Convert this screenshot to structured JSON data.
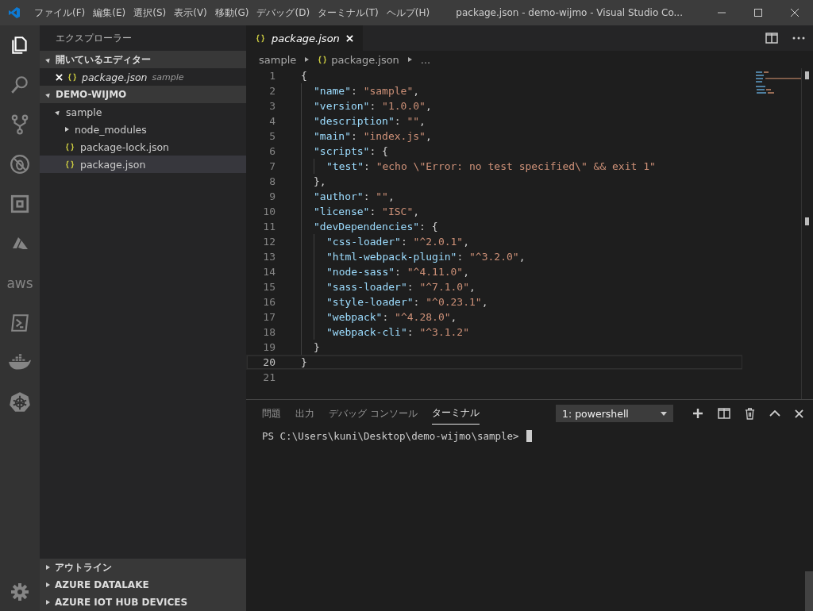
{
  "window": {
    "title": "package.json - demo-wijmo - Visual Studio Co..."
  },
  "menu": [
    "ファイル(F)",
    "編集(E)",
    "選択(S)",
    "表示(V)",
    "移動(G)",
    "デバッグ(D)",
    "ターミナル(T)",
    "ヘルプ(H)"
  ],
  "activity_bar": [
    {
      "kind": "files",
      "selected": true
    },
    {
      "kind": "search",
      "selected": false
    },
    {
      "kind": "git",
      "selected": false
    },
    {
      "kind": "debug",
      "selected": false
    },
    {
      "kind": "extensions",
      "selected": false
    },
    {
      "kind": "azure",
      "selected": false
    },
    {
      "kind": "aws",
      "label": "aws",
      "selected": false
    },
    {
      "kind": "powershell",
      "selected": false
    },
    {
      "kind": "docker",
      "selected": false
    },
    {
      "kind": "kubernetes",
      "selected": false
    }
  ],
  "sidebar": {
    "title": "エクスプローラー",
    "open_editors": {
      "title": "開いているエディター",
      "expanded": true,
      "items": [
        {
          "name": "package.json",
          "folder": "sample"
        }
      ]
    },
    "workspace": {
      "title": "DEMO-WIJMO",
      "expanded": true,
      "children": [
        {
          "name": "sample",
          "kind": "folder",
          "expanded": true,
          "selected": false,
          "children": [
            {
              "name": "node_modules",
              "kind": "folder",
              "expanded": false,
              "selected": false
            },
            {
              "name": "package-lock.json",
              "kind": "json",
              "selected": false
            },
            {
              "name": "package.json",
              "kind": "json",
              "selected": true
            }
          ]
        }
      ]
    },
    "sections": [
      {
        "title": "アウトライン",
        "expanded": false
      },
      {
        "title": "AZURE DATALAKE",
        "expanded": false
      },
      {
        "title": "AZURE IOT HUB DEVICES",
        "expanded": false
      }
    ]
  },
  "editor": {
    "tabs": [
      {
        "name": "package.json",
        "selected": true
      }
    ],
    "breadcrumbs": [
      "sample",
      "package.json",
      "..."
    ],
    "lines": [
      {
        "number": "1",
        "current": false,
        "tokens": [
          {
            "kind": "punct",
            "text": "{"
          }
        ]
      },
      {
        "number": "2",
        "current": false,
        "tokens": [
          {
            "kind": "key",
            "text": "  \"name\""
          },
          {
            "kind": "punct",
            "text": ": "
          },
          {
            "kind": "string",
            "text": "\"sample\""
          },
          {
            "kind": "punct",
            "text": ","
          }
        ]
      },
      {
        "number": "3",
        "current": false,
        "tokens": [
          {
            "kind": "key",
            "text": "  \"version\""
          },
          {
            "kind": "punct",
            "text": ": "
          },
          {
            "kind": "string",
            "text": "\"1.0.0\""
          },
          {
            "kind": "punct",
            "text": ","
          }
        ]
      },
      {
        "number": "4",
        "current": false,
        "tokens": [
          {
            "kind": "key",
            "text": "  \"description\""
          },
          {
            "kind": "punct",
            "text": ": "
          },
          {
            "kind": "string",
            "text": "\"\""
          },
          {
            "kind": "punct",
            "text": ","
          }
        ]
      },
      {
        "number": "5",
        "current": false,
        "tokens": [
          {
            "kind": "key",
            "text": "  \"main\""
          },
          {
            "kind": "punct",
            "text": ": "
          },
          {
            "kind": "string",
            "text": "\"index.js\""
          },
          {
            "kind": "punct",
            "text": ","
          }
        ]
      },
      {
        "number": "6",
        "current": false,
        "tokens": [
          {
            "kind": "key",
            "text": "  \"scripts\""
          },
          {
            "kind": "punct",
            "text": ": {"
          }
        ]
      },
      {
        "number": "7",
        "current": false,
        "tokens": [
          {
            "kind": "key",
            "text": "    \"test\""
          },
          {
            "kind": "punct",
            "text": ": "
          },
          {
            "kind": "string",
            "text": "\"echo \\\"Error: no test specified\\\" && exit 1\""
          }
        ]
      },
      {
        "number": "8",
        "current": false,
        "tokens": [
          {
            "kind": "punct",
            "text": "  },"
          }
        ]
      },
      {
        "number": "9",
        "current": false,
        "tokens": [
          {
            "kind": "key",
            "text": "  \"author\""
          },
          {
            "kind": "punct",
            "text": ": "
          },
          {
            "kind": "string",
            "text": "\"\""
          },
          {
            "kind": "punct",
            "text": ","
          }
        ]
      },
      {
        "number": "10",
        "current": false,
        "tokens": [
          {
            "kind": "key",
            "text": "  \"license\""
          },
          {
            "kind": "punct",
            "text": ": "
          },
          {
            "kind": "string",
            "text": "\"ISC\""
          },
          {
            "kind": "punct",
            "text": ","
          }
        ]
      },
      {
        "number": "11",
        "current": false,
        "tokens": [
          {
            "kind": "key",
            "text": "  \"devDependencies\""
          },
          {
            "kind": "punct",
            "text": ": {"
          }
        ]
      },
      {
        "number": "12",
        "current": false,
        "tokens": [
          {
            "kind": "key",
            "text": "    \"css-loader\""
          },
          {
            "kind": "punct",
            "text": ": "
          },
          {
            "kind": "string",
            "text": "\"^2.0.1\""
          },
          {
            "kind": "punct",
            "text": ","
          }
        ]
      },
      {
        "number": "13",
        "current": false,
        "tokens": [
          {
            "kind": "key",
            "text": "    \"html-webpack-plugin\""
          },
          {
            "kind": "punct",
            "text": ": "
          },
          {
            "kind": "string",
            "text": "\"^3.2.0\""
          },
          {
            "kind": "punct",
            "text": ","
          }
        ]
      },
      {
        "number": "14",
        "current": false,
        "tokens": [
          {
            "kind": "key",
            "text": "    \"node-sass\""
          },
          {
            "kind": "punct",
            "text": ": "
          },
          {
            "kind": "string",
            "text": "\"^4.11.0\""
          },
          {
            "kind": "punct",
            "text": ","
          }
        ]
      },
      {
        "number": "15",
        "current": false,
        "tokens": [
          {
            "kind": "key",
            "text": "    \"sass-loader\""
          },
          {
            "kind": "punct",
            "text": ": "
          },
          {
            "kind": "string",
            "text": "\"^7.1.0\""
          },
          {
            "kind": "punct",
            "text": ","
          }
        ]
      },
      {
        "number": "16",
        "current": false,
        "tokens": [
          {
            "kind": "key",
            "text": "    \"style-loader\""
          },
          {
            "kind": "punct",
            "text": ": "
          },
          {
            "kind": "string",
            "text": "\"^0.23.1\""
          },
          {
            "kind": "punct",
            "text": ","
          }
        ]
      },
      {
        "number": "17",
        "current": false,
        "tokens": [
          {
            "kind": "key",
            "text": "    \"webpack\""
          },
          {
            "kind": "punct",
            "text": ": "
          },
          {
            "kind": "string",
            "text": "\"^4.28.0\""
          },
          {
            "kind": "punct",
            "text": ","
          }
        ]
      },
      {
        "number": "18",
        "current": false,
        "tokens": [
          {
            "kind": "key",
            "text": "    \"webpack-cli\""
          },
          {
            "kind": "punct",
            "text": ": "
          },
          {
            "kind": "string",
            "text": "\"^3.1.2\""
          }
        ]
      },
      {
        "number": "19",
        "current": false,
        "tokens": [
          {
            "kind": "punct",
            "text": "  }"
          }
        ]
      },
      {
        "number": "20",
        "current": true,
        "tokens": [
          {
            "kind": "punct",
            "text": "}"
          }
        ]
      },
      {
        "number": "21",
        "current": false
      }
    ]
  },
  "panel": {
    "tabs": [
      {
        "label": "問題",
        "selected": false
      },
      {
        "label": "出力",
        "selected": false
      },
      {
        "label": "デバッグ コンソール",
        "selected": false
      },
      {
        "label": "ターミナル",
        "selected": true
      }
    ],
    "terminal_select": "1: powershell",
    "terminal_lines": [
      "PS C:\\Users\\kuni\\Desktop\\demo-wijmo\\sample> "
    ]
  }
}
